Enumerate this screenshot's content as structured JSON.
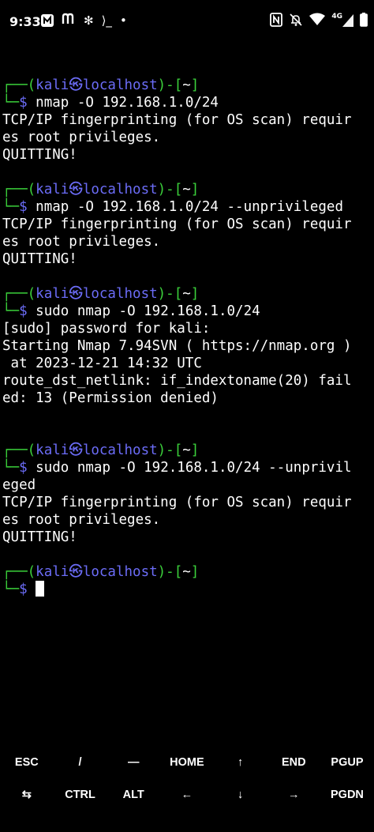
{
  "status_bar": {
    "time": "9:33",
    "network_type": "4G",
    "left_icons": [
      "app-n-icon",
      "app-m-icon",
      "pinwheel-icon",
      "terminal-prompt-icon",
      "dot-icon"
    ],
    "right_icons": [
      "nfc-icon",
      "silent-icon",
      "wifi-icon",
      "signal-icon",
      "battery-icon"
    ],
    "glyphs": {
      "pinwheel": "✻",
      "terminal_prompt": "⟩_",
      "dot": "•"
    }
  },
  "terminal": {
    "lines": [
      {
        "type": "blank"
      },
      {
        "type": "prompt_top",
        "user": "kali",
        "host": "localhost",
        "dir": "~"
      },
      {
        "type": "prompt_cmd",
        "cmd": "nmap -O 192.168.1.0/24"
      },
      {
        "type": "out",
        "text": "TCP/IP fingerprinting (for OS scan) requir"
      },
      {
        "type": "out",
        "text": "es root privileges."
      },
      {
        "type": "out",
        "text": "QUITTING!"
      },
      {
        "type": "blank"
      },
      {
        "type": "prompt_top",
        "user": "kali",
        "host": "localhost",
        "dir": "~"
      },
      {
        "type": "prompt_cmd",
        "cmd": "nmap -O 192.168.1.0/24 --unprivileged"
      },
      {
        "type": "out",
        "text": "TCP/IP fingerprinting (for OS scan) requir"
      },
      {
        "type": "out",
        "text": "es root privileges."
      },
      {
        "type": "out",
        "text": "QUITTING!"
      },
      {
        "type": "blank"
      },
      {
        "type": "prompt_top",
        "user": "kali",
        "host": "localhost",
        "dir": "~"
      },
      {
        "type": "prompt_cmd",
        "cmd": "sudo nmap -O 192.168.1.0/24"
      },
      {
        "type": "out",
        "text": "[sudo] password for kali:"
      },
      {
        "type": "out",
        "text": "Starting Nmap 7.94SVN ( https://nmap.org )"
      },
      {
        "type": "out",
        "text": " at 2023-12-21 14:32 UTC"
      },
      {
        "type": "out",
        "text": "route_dst_netlink: if_indextoname(20) fail"
      },
      {
        "type": "out",
        "text": "ed: 13 (Permission denied)"
      },
      {
        "type": "blank"
      },
      {
        "type": "blank"
      },
      {
        "type": "prompt_top",
        "user": "kali",
        "host": "localhost",
        "dir": "~"
      },
      {
        "type": "prompt_cmd",
        "cmd": "sudo nmap -O 192.168.1.0/24 --unprivil"
      },
      {
        "type": "out",
        "text": "eged"
      },
      {
        "type": "out",
        "text": "TCP/IP fingerprinting (for OS scan) requir"
      },
      {
        "type": "out",
        "text": "es root privileges."
      },
      {
        "type": "out",
        "text": "QUITTING!"
      },
      {
        "type": "blank"
      },
      {
        "type": "prompt_top",
        "user": "kali",
        "host": "localhost",
        "dir": "~"
      },
      {
        "type": "prompt_active"
      }
    ],
    "prompt_glyphs": {
      "top_left": "┌──(",
      "skull": "㉿",
      "mid": ")-[",
      "end": "]",
      "bottom_left": "└─",
      "dollar": "$"
    },
    "colors": {
      "prompt_green": "#3bd13b",
      "prompt_blue": "#6b6cf6",
      "text": "#ffffff",
      "background": "#000000"
    }
  },
  "extra_keys": {
    "row1": [
      "ESC",
      "/",
      "—",
      "HOME",
      "↑",
      "END",
      "PGUP"
    ],
    "row2": [
      "⇆",
      "CTRL",
      "ALT",
      "←",
      "↓",
      "→",
      "PGDN"
    ]
  }
}
